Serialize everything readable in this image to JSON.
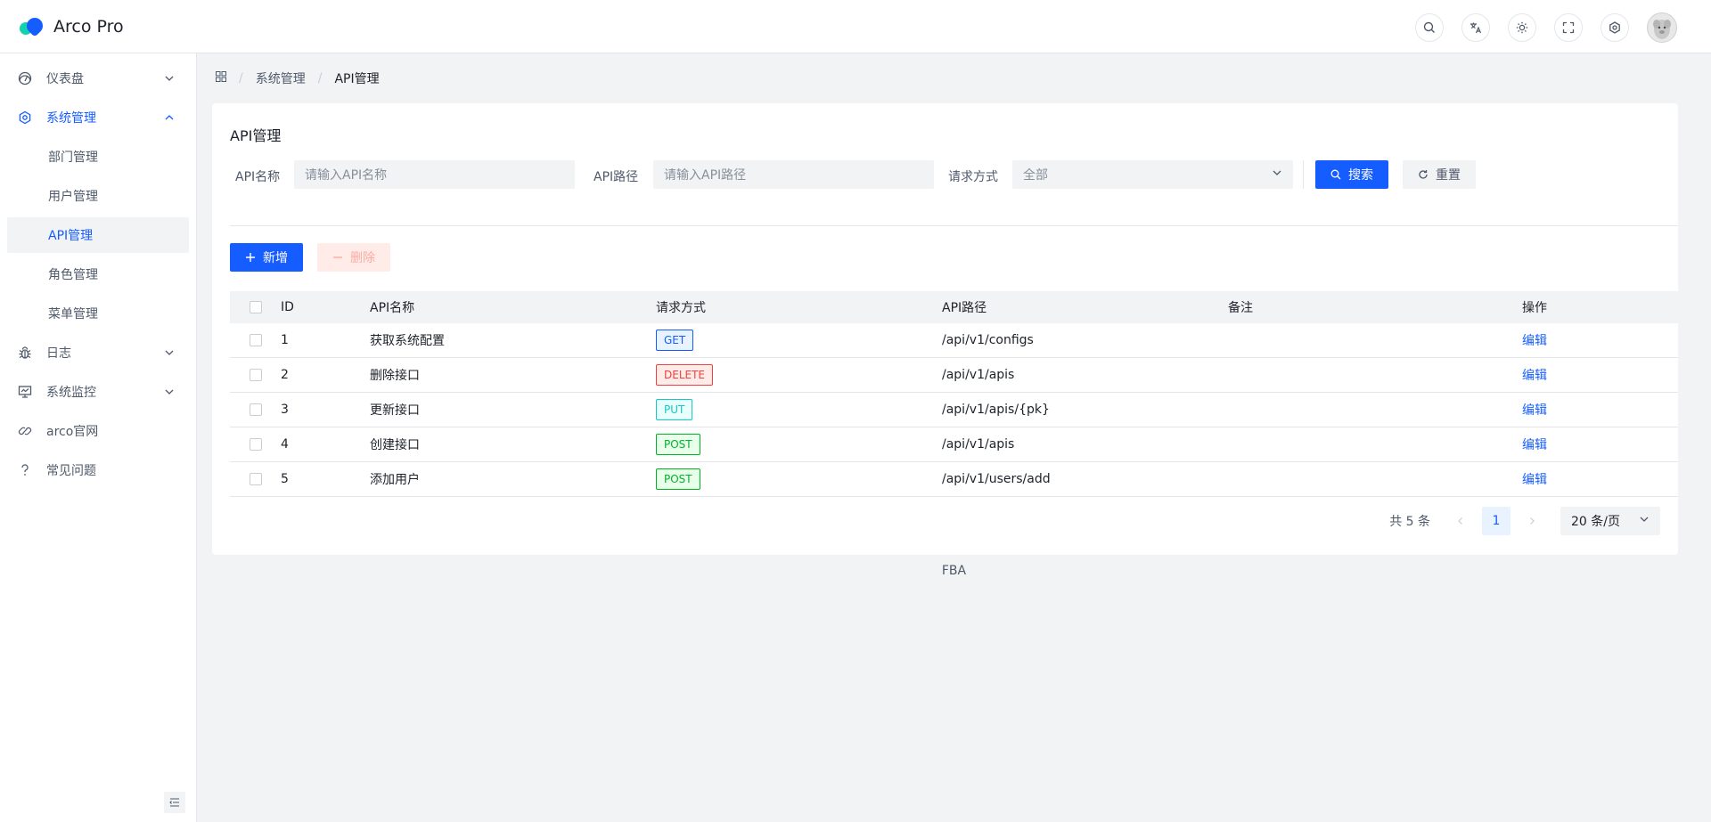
{
  "app": {
    "title": "Arco Pro"
  },
  "header": {
    "icons": [
      "search-icon",
      "translate-icon",
      "theme-icon",
      "fullscreen-icon",
      "settings-icon"
    ]
  },
  "sidebar": {
    "items": [
      {
        "label": "仪表盘",
        "icon": "dashboard-icon",
        "expandable": true,
        "open": false
      },
      {
        "label": "系统管理",
        "icon": "settings-icon",
        "expandable": true,
        "open": true,
        "children": [
          {
            "label": "部门管理",
            "active": false
          },
          {
            "label": "用户管理",
            "active": false
          },
          {
            "label": "API管理",
            "active": true
          },
          {
            "label": "角色管理",
            "active": false
          },
          {
            "label": "菜单管理",
            "active": false
          }
        ]
      },
      {
        "label": "日志",
        "icon": "bug-icon",
        "expandable": true,
        "open": false
      },
      {
        "label": "系统监控",
        "icon": "monitor-icon",
        "expandable": true,
        "open": false
      },
      {
        "label": "arco官网",
        "icon": "link-icon",
        "expandable": false
      },
      {
        "label": "常见问题",
        "icon": "question-icon",
        "expandable": false
      }
    ]
  },
  "breadcrumb": {
    "level1": "系统管理",
    "level2": "API管理"
  },
  "card": {
    "title": "API管理"
  },
  "filters": {
    "name_label": "API名称",
    "name_placeholder": "请输入API名称",
    "path_label": "API路径",
    "path_placeholder": "请输入API路径",
    "method_label": "请求方式",
    "method_value": "全部",
    "search_label": "搜索",
    "reset_label": "重置"
  },
  "toolbar": {
    "add_label": "新增",
    "delete_label": "删除"
  },
  "table": {
    "headers": {
      "id": "ID",
      "name": "API名称",
      "method": "请求方式",
      "path": "API路径",
      "remark": "备注",
      "op": "操作"
    },
    "rows": [
      {
        "id": "1",
        "name": "获取系统配置",
        "method": "GET",
        "path": "/api/v1/configs",
        "remark": "",
        "op": "编辑"
      },
      {
        "id": "2",
        "name": "删除接口",
        "method": "DELETE",
        "path": "/api/v1/apis",
        "remark": "",
        "op": "编辑"
      },
      {
        "id": "3",
        "name": "更新接口",
        "method": "PUT",
        "path": "/api/v1/apis/{pk}",
        "remark": "",
        "op": "编辑"
      },
      {
        "id": "4",
        "name": "创建接口",
        "method": "POST",
        "path": "/api/v1/apis",
        "remark": "",
        "op": "编辑"
      },
      {
        "id": "5",
        "name": "添加用户",
        "method": "POST",
        "path": "/api/v1/users/add",
        "remark": "",
        "op": "编辑"
      }
    ]
  },
  "method_colors": {
    "GET": {
      "color": "#165dff",
      "bg": "#e8f3ff"
    },
    "DELETE": {
      "color": "#f53f3f",
      "bg": "#ffece8"
    },
    "PUT": {
      "color": "#14c9c9",
      "bg": "#e8fffb"
    },
    "POST": {
      "color": "#00b42a",
      "bg": "#e8ffea"
    }
  },
  "pagination": {
    "total_text": "共 5 条",
    "current_page": "1",
    "page_size": "20 条/页"
  },
  "footer": {
    "text": "FBA"
  }
}
